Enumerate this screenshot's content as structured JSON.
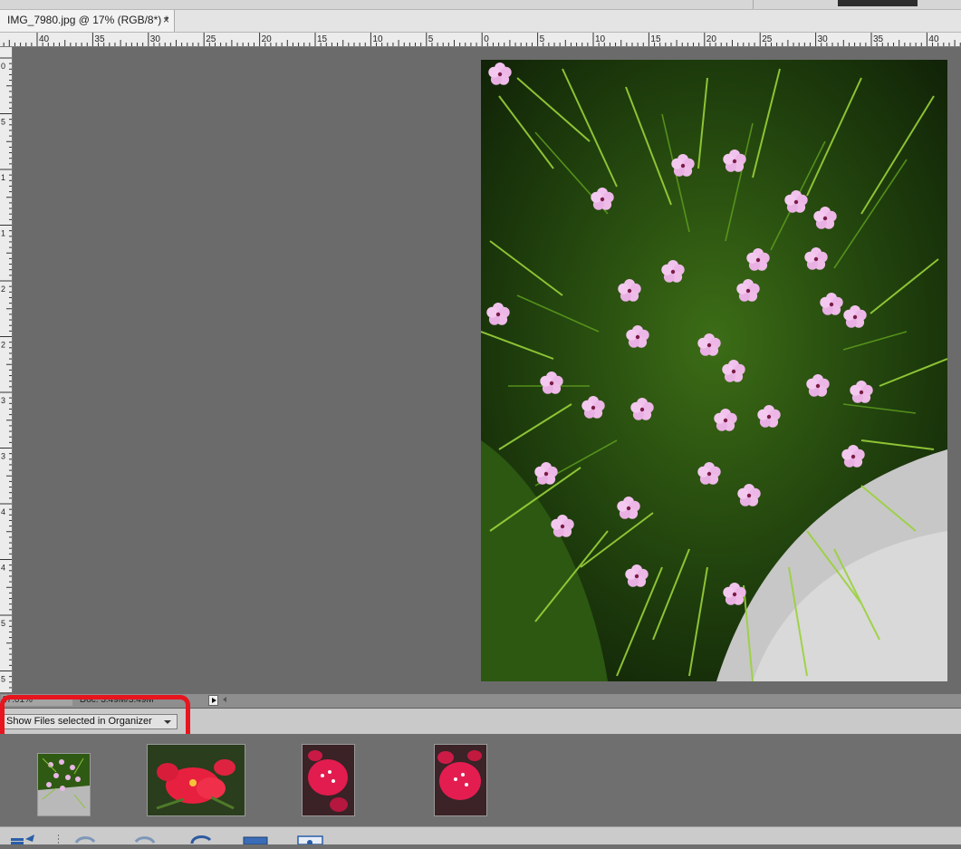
{
  "document_tab": {
    "title": "IMG_7980.jpg @ 17% (RGB/8*) *",
    "close_label": "×"
  },
  "rulers": {
    "horizontal_labels": [
      "40",
      "35",
      "30",
      "25",
      "20",
      "15",
      "10",
      "5",
      "0",
      "5",
      "10",
      "15",
      "20",
      "25",
      "30",
      "35",
      "40"
    ],
    "vertical_labels": [
      "0",
      "5",
      "1",
      "1",
      "2",
      "2",
      "3",
      "3",
      "4",
      "4",
      "5",
      "5"
    ]
  },
  "status_bar": {
    "zoom": "17.01%",
    "doc_info": "Doc: 3.49M/3.49M"
  },
  "photo_bin": {
    "show_select_value": "Show Files selected in Organizer",
    "thumbnails": [
      {
        "name": "thumbnail-pink-flower-shrub"
      },
      {
        "name": "thumbnail-red-trumpet-flowers"
      },
      {
        "name": "thumbnail-magenta-bougainvillea-1"
      },
      {
        "name": "thumbnail-magenta-bougainvillea-2"
      }
    ]
  },
  "icons": {
    "close": "close-icon",
    "status_menu": "triangle-right-icon",
    "dropdown": "chevron-down-icon",
    "bin_actions": "bin-actions-icon",
    "undo": "undo-icon",
    "redo": "redo-icon",
    "rotate": "rotate-icon",
    "layout": "layout-icon",
    "organizer": "organizer-icon"
  },
  "colors": {
    "highlight": "#e8141e",
    "canvas_bg": "#6b6b6b"
  }
}
